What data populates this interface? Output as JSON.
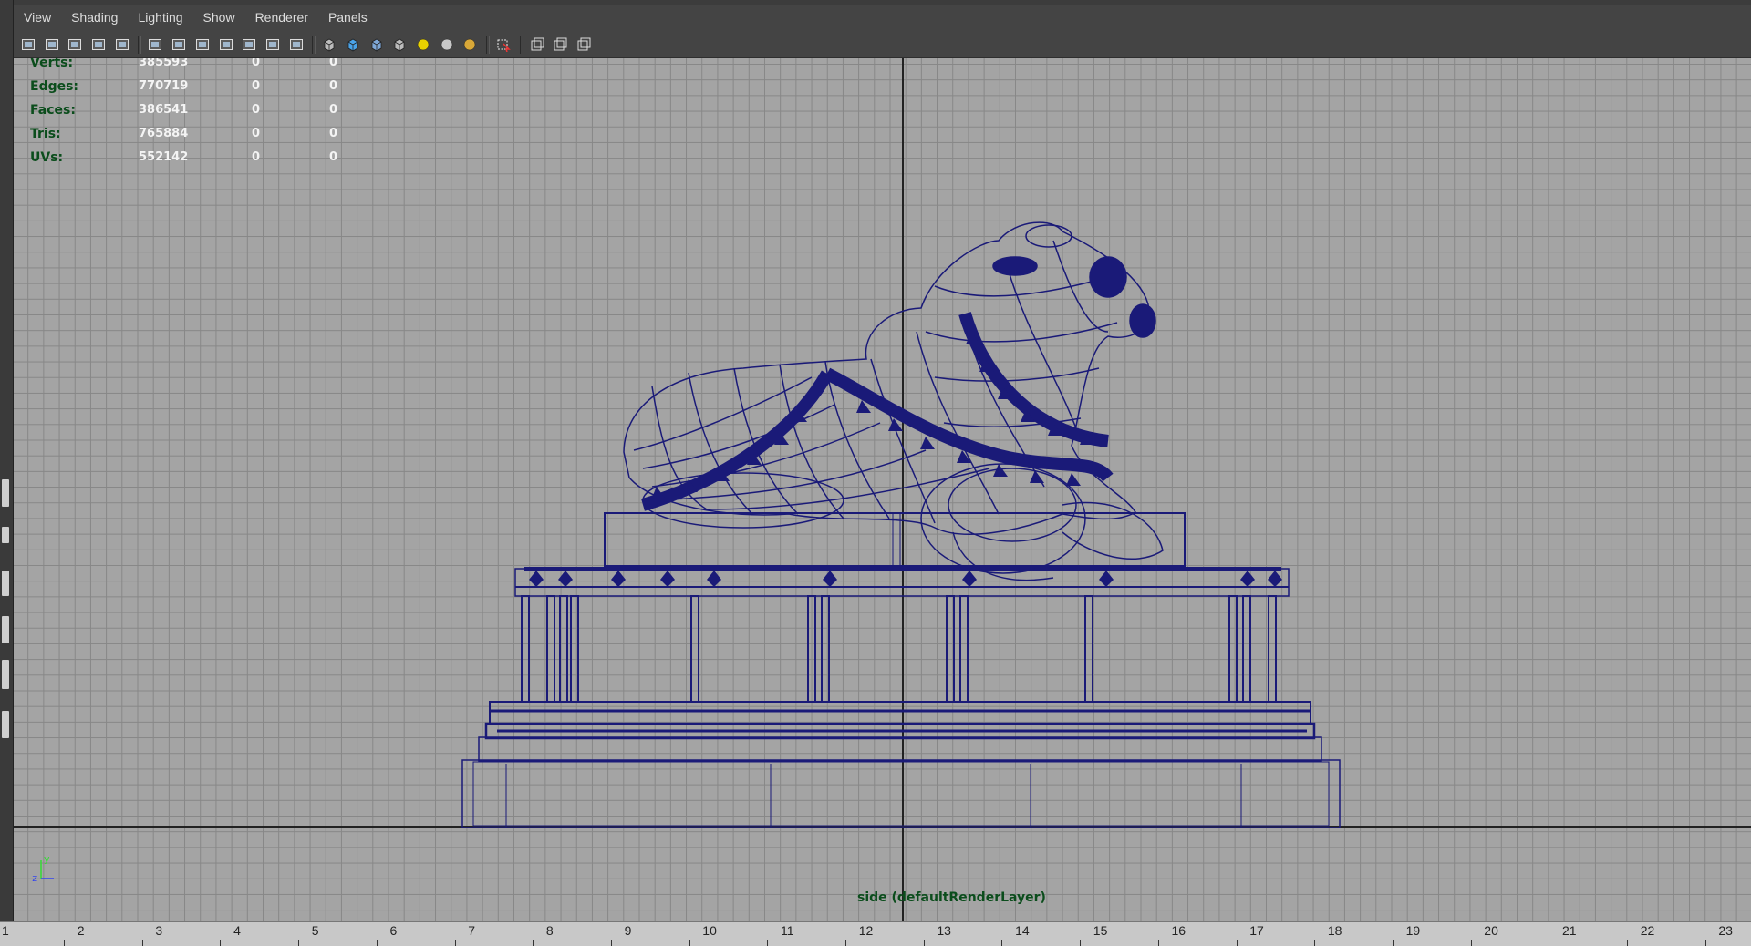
{
  "menu": [
    "View",
    "Shading",
    "Lighting",
    "Show",
    "Renderer",
    "Panels"
  ],
  "toolbar_icons": [
    "select-camera-icon",
    "camera-attributes-icon",
    "bookmarks-icon",
    "image-plane-icon",
    "2d-pan-zoom-icon",
    "separator",
    "grid-icon",
    "film-gate-icon",
    "resolution-gate-icon",
    "gate-mask-icon",
    "field-chart-icon",
    "safe-action-icon",
    "safe-title-icon",
    "separator",
    "wireframe-icon",
    "smooth-shade-icon",
    "wireframe-on-shaded-icon",
    "textured-icon",
    "use-all-lights-icon",
    "shadows-icon",
    "ambient-occlusion-icon",
    "separator",
    "isolate-select-icon",
    "separator",
    "xray-icon",
    "xray-joints-icon",
    "xray-components-icon"
  ],
  "hud": {
    "rows": [
      {
        "label": "Verts:",
        "value": "385593",
        "selected": "0",
        "uvs": "0"
      },
      {
        "label": "Edges:",
        "value": "770719",
        "selected": "0",
        "uvs": "0"
      },
      {
        "label": "Faces:",
        "value": "386541",
        "selected": "0",
        "uvs": "0"
      },
      {
        "label": "Tris:",
        "value": "765884",
        "selected": "0",
        "uvs": "0"
      },
      {
        "label": "UVs:",
        "value": "552142",
        "selected": "0",
        "uvs": "0"
      }
    ]
  },
  "viewport": {
    "camera_label": "side (defaultRenderLayer)",
    "background_color": "#a4a4a4",
    "grid_color": "#878787",
    "wire_color": "#1a1a78",
    "axis_labels": [
      "z",
      "y"
    ]
  },
  "timeline": {
    "ticks": [
      "1",
      "2",
      "3",
      "4",
      "5",
      "6",
      "7",
      "8",
      "9",
      "10",
      "11",
      "12",
      "13",
      "14",
      "15",
      "16",
      "17",
      "18",
      "19",
      "20",
      "21",
      "22",
      "23"
    ]
  }
}
